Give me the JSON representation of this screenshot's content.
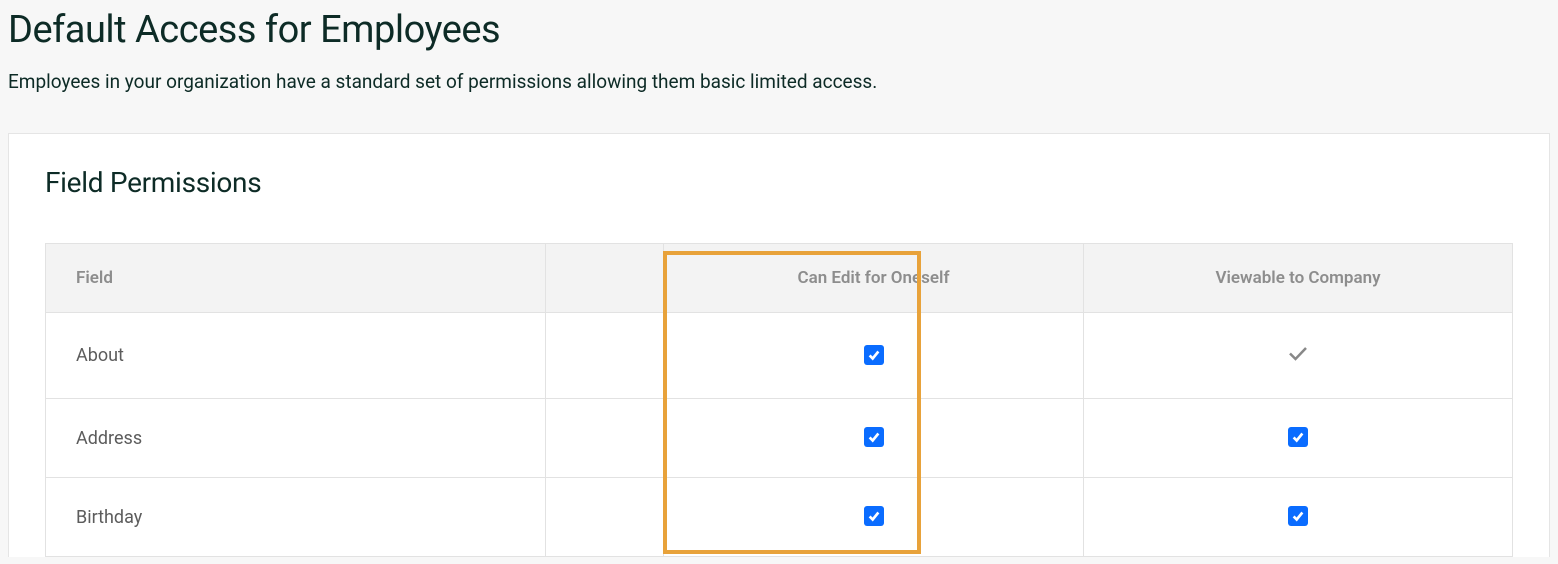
{
  "page": {
    "title": "Default Access for Employees",
    "subtitle": "Employees in your organization have a standard set of permissions allowing them basic limited access."
  },
  "section": {
    "title": "Field Permissions"
  },
  "table": {
    "headers": {
      "field": "Field",
      "edit": "Can Edit for Oneself",
      "view": "Viewable to Company"
    },
    "rows": [
      {
        "field": "About",
        "can_edit": true,
        "viewable": "static-check"
      },
      {
        "field": "Address",
        "can_edit": true,
        "viewable": true
      },
      {
        "field": "Birthday",
        "can_edit": true,
        "viewable": true
      }
    ]
  }
}
